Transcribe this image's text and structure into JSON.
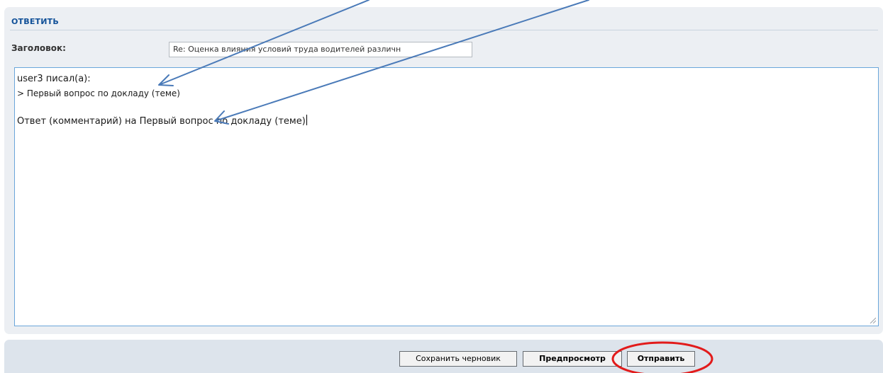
{
  "panel": {
    "header": "ОТВЕТИТЬ"
  },
  "subject": {
    "label": "Заголовок:",
    "value": "Re: Оценка влияния условий труда водителей различн"
  },
  "message": {
    "lines": [
      "user3 писал(а):",
      "> Первый вопрос по докладу (теме)",
      "",
      "Ответ (комментарий) на Первый вопрос по докладу (теме)"
    ]
  },
  "buttons": {
    "save_draft": "Сохранить черновик",
    "preview": "Предпросмотр",
    "submit": "Отправить"
  },
  "annotations": {
    "arrow_color": "#4a7ab8",
    "highlight_color": "#e21b1b"
  }
}
